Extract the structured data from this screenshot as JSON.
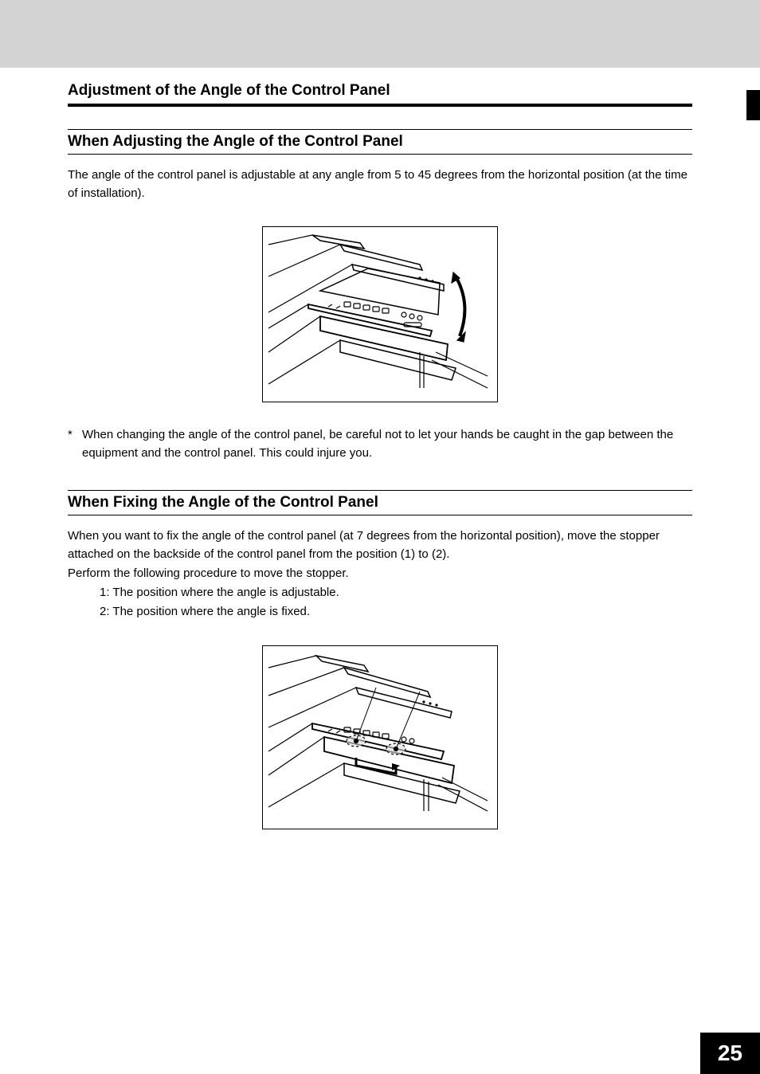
{
  "page_title": "Adjustment of the Angle of the Control Panel",
  "section1": {
    "heading": "When Adjusting the Angle of the Control Panel",
    "body": "The angle of the control panel is adjustable at any angle from 5 to 45 degrees from the horizontal position (at the time of installation).",
    "note_marker": "*",
    "note": "When changing the angle of the control panel, be careful not to let your hands be caught in the gap between the equipment and the control panel. This could injure you."
  },
  "section2": {
    "heading": "When Fixing the Angle of the Control Panel",
    "body1": "When you want to fix the angle of the control panel (at 7 degrees from the horizontal position), move the stopper attached on the backside of the control panel from the position (1) to (2).",
    "body2": "Perform the following procedure to move the stopper.",
    "list1": "1: The position where the angle is adjustable.",
    "list2": "2: The position where the angle is fixed."
  },
  "page_number": "25"
}
